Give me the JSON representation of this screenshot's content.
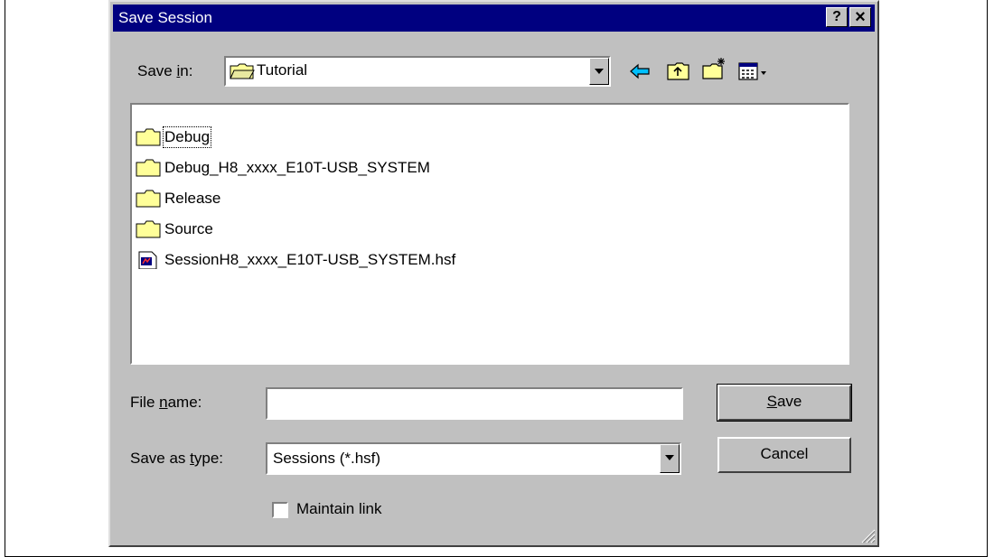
{
  "window": {
    "title": "Save Session",
    "help_label": "?",
    "close_label": "×"
  },
  "save_in": {
    "label_pre": "Save ",
    "label_key": "i",
    "label_post": "n:",
    "value": "Tutorial"
  },
  "files": [
    {
      "name": "Debug",
      "icon": "folder-icon"
    },
    {
      "name": "Debug_H8_xxxx_E10T-USB_SYSTEM",
      "icon": "folder-icon"
    },
    {
      "name": "Release",
      "icon": "folder-icon"
    },
    {
      "name": "Source",
      "icon": "folder-icon"
    },
    {
      "name": "SessionH8_xxxx_E10T-USB_SYSTEM.hsf",
      "icon": "session-file-icon"
    }
  ],
  "file_name": {
    "label_pre": "File ",
    "label_key": "n",
    "label_post": "ame:",
    "value": ""
  },
  "save_as_type": {
    "label_pre": "Save as ",
    "label_key": "t",
    "label_post": "ype:",
    "value": "Sessions (*.hsf)"
  },
  "buttons": {
    "save_key": "S",
    "save_rest": "ave",
    "cancel": "Cancel"
  },
  "maintain_link": {
    "label": "Maintain link",
    "checked": false
  },
  "colors": {
    "titlebar": "#000080",
    "face": "#c0c0c0",
    "folder": "#ffff99"
  }
}
